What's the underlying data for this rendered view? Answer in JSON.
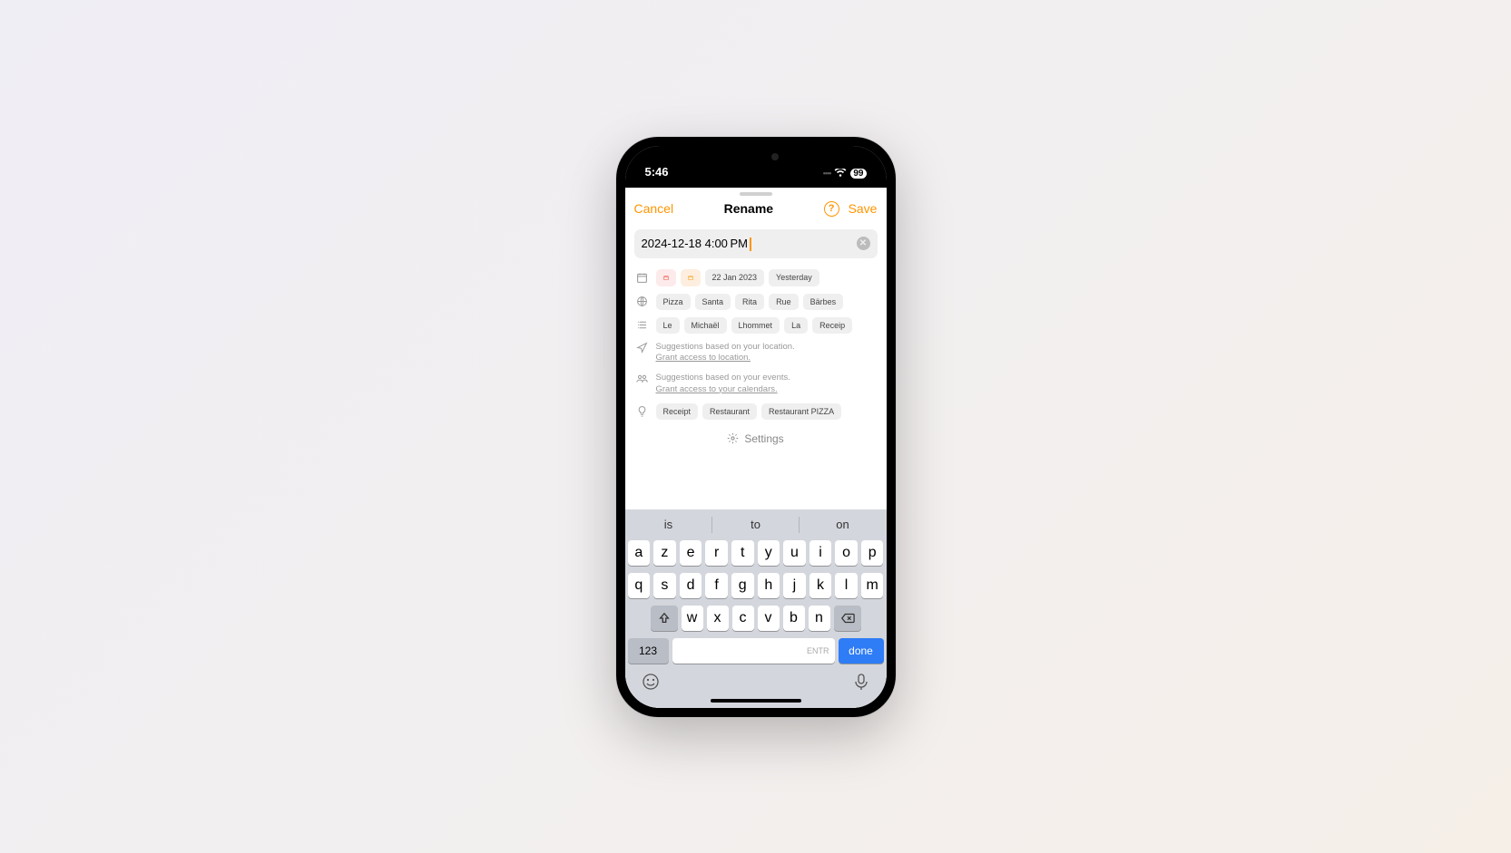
{
  "status": {
    "time": "5:46",
    "battery": "99"
  },
  "header": {
    "cancel": "Cancel",
    "title": "Rename",
    "save": "Save"
  },
  "input": {
    "value": "2024-12-18 4:00 PM"
  },
  "date_row": {
    "chips": [
      "22 Jan 2023",
      "Yesterday"
    ]
  },
  "globe_row": {
    "chips": [
      "Pizza",
      "Santa",
      "Rita",
      "Rue",
      "Bärbes"
    ]
  },
  "list_row": {
    "chips": [
      "Le",
      "Michaël",
      "Lhommet",
      "La",
      "Receip"
    ]
  },
  "location_info": {
    "text": "Suggestions based on your location.",
    "link": "Grant access to location."
  },
  "events_info": {
    "text": "Suggestions based on your events.",
    "link": "Grant access to your calendars."
  },
  "bulb_row": {
    "chips": [
      "Receipt",
      "Restaurant",
      "Restaurant PIZZA"
    ]
  },
  "settings": {
    "label": "Settings"
  },
  "keyboard": {
    "suggestions": [
      "is",
      "to",
      "on"
    ],
    "row1": [
      "a",
      "z",
      "e",
      "r",
      "t",
      "y",
      "u",
      "i",
      "o",
      "p"
    ],
    "row2": [
      "q",
      "s",
      "d",
      "f",
      "g",
      "h",
      "j",
      "k",
      "l",
      "m"
    ],
    "row3": [
      "w",
      "x",
      "c",
      "v",
      "b",
      "n"
    ],
    "numeric": "123",
    "space_hint": "ENTR",
    "done": "done"
  }
}
